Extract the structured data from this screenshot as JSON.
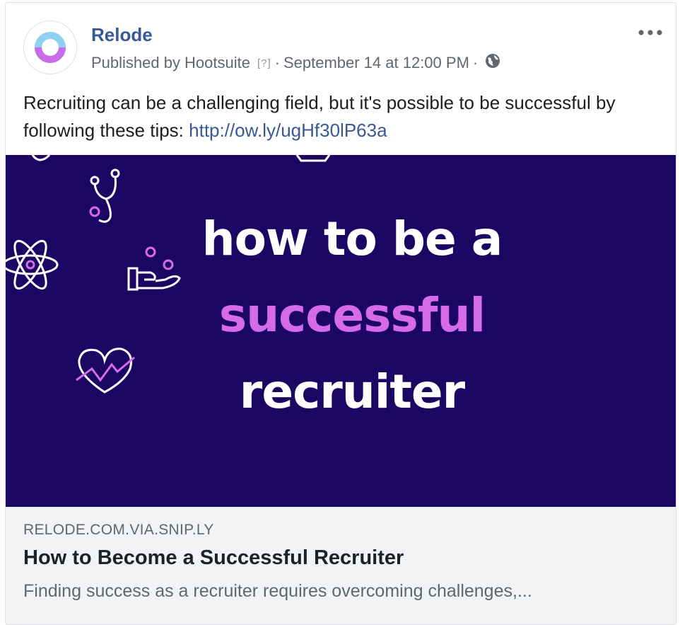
{
  "post": {
    "page_name": "Relode",
    "published_by_prefix": "Published by",
    "publisher": "Hootsuite",
    "help_marker": "[?]",
    "separator": "·",
    "timestamp": "September 14 at 12:00 PM",
    "audience_icon": "globe-icon",
    "more_icon": "more-options-icon",
    "text": "Recruiting can be a challenging field, but it's possible to be successful by following these tips:",
    "url": "http://ow.ly/ugHf30lP63a"
  },
  "image": {
    "line1": "how to be a",
    "line2": "successful",
    "line3": "recruiter",
    "icons": [
      "stethoscope-icon",
      "atom-icon",
      "hand-coins-icon",
      "heart-rate-icon"
    ]
  },
  "link_preview": {
    "domain": "RELODE.COM.VIA.SNIP.LY",
    "title": "How to Become a Successful Recruiter",
    "description": "Finding success as a recruiter requires overcoming challenges,..."
  },
  "colors": {
    "link_blue": "#385898",
    "image_bg": "#1c0663",
    "accent_purple": "#d66be8",
    "meta_gray": "#606770"
  }
}
